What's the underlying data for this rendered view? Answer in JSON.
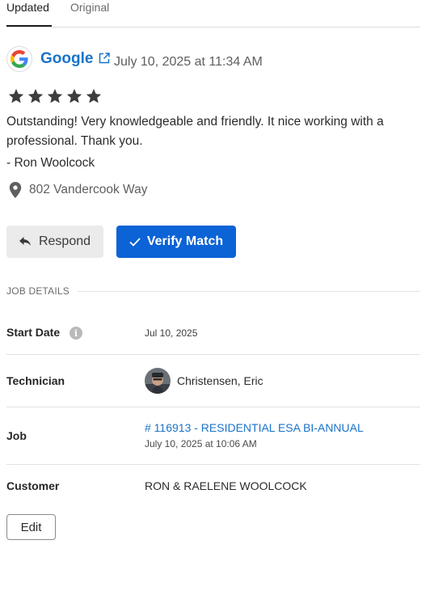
{
  "tabs": [
    {
      "label": "Updated",
      "active": true
    },
    {
      "label": "Original",
      "active": false
    }
  ],
  "review": {
    "source": "Google",
    "source_icon": "google-logo-icon",
    "date": "July 10, 2025 at 11:34 AM",
    "rating": 5,
    "rating_max": 5,
    "text": "Outstanding! Very knowledgeable and friendly. It nice working with a professional. Thank you.",
    "reviewer": "- Ron Woolcock",
    "address": "802 Vandercook Way"
  },
  "actions": {
    "respond_label": "Respond",
    "verify_label": "Verify Match"
  },
  "job_details": {
    "section_label": "JOB DETAILS",
    "start_date_label": "Start Date",
    "start_date_value": "Jul 10, 2025",
    "technician_label": "Technician",
    "technician_value": "Christensen, Eric",
    "job_label": "Job",
    "job_link": "# 116913 - RESIDENTIAL ESA BI-ANNUAL",
    "job_date": "July 10, 2025 at 10:06 AM",
    "customer_label": "Customer",
    "customer_value": "RON & RAELENE WOOLCOCK"
  },
  "edit_label": "Edit",
  "colors": {
    "accent": "#0b63d6",
    "link": "#1a73c8",
    "star": "#3d3d3d"
  }
}
